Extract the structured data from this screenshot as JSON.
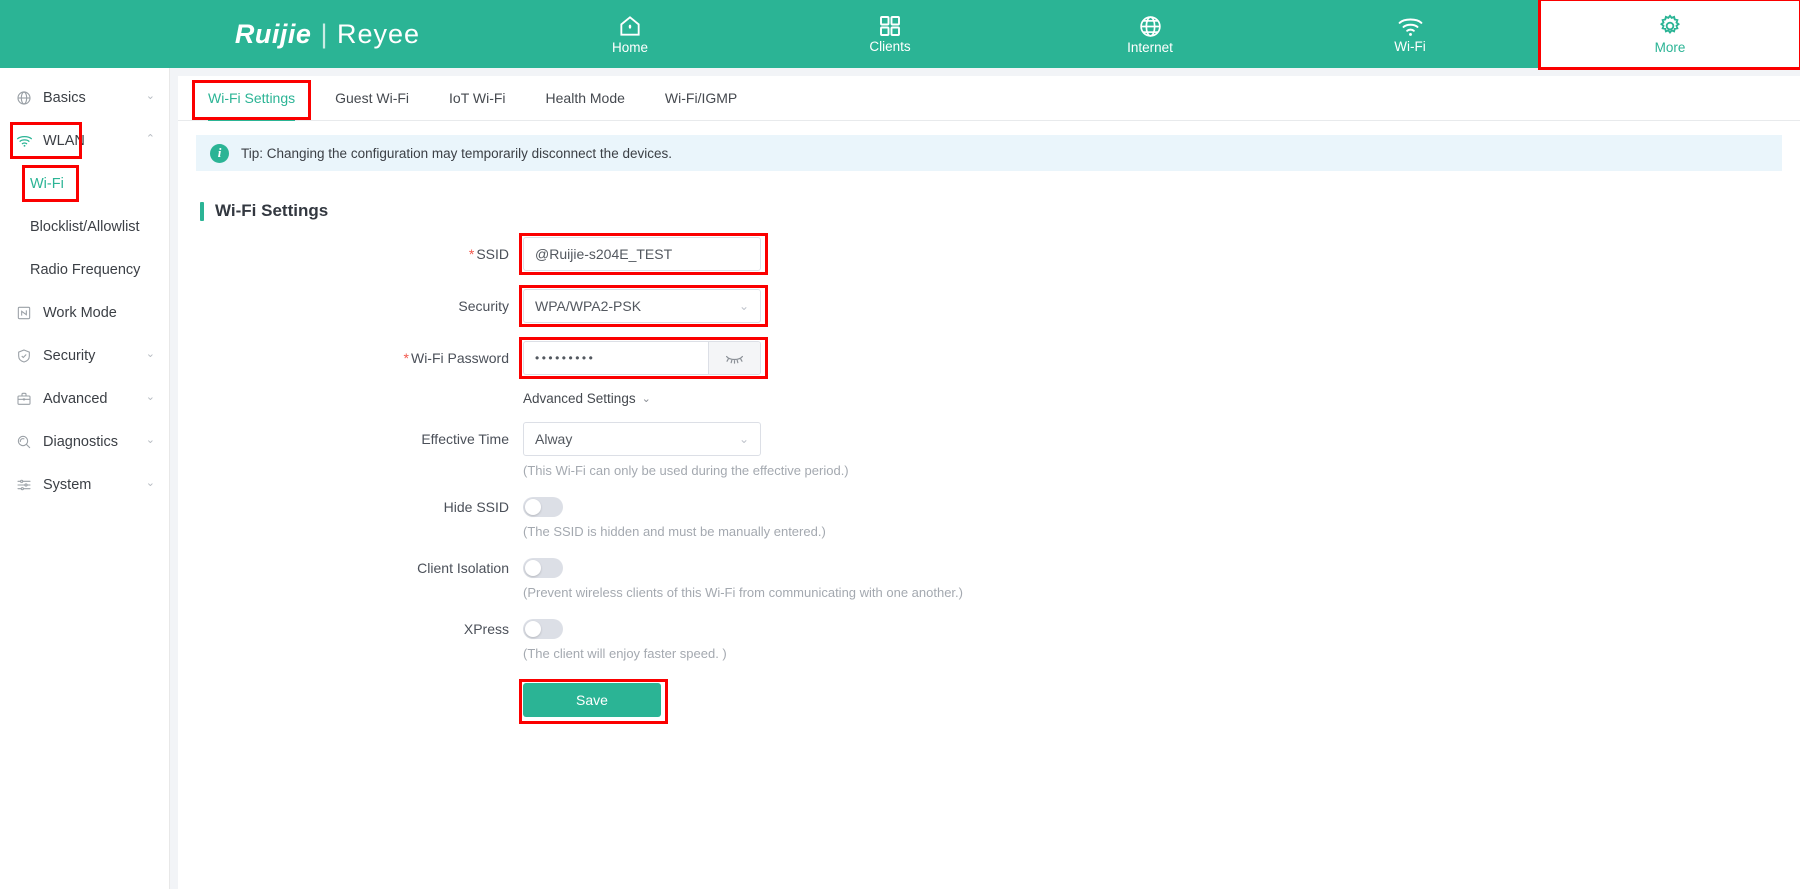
{
  "header": {
    "brand_primary": "Ruijie",
    "brand_separator": "|",
    "brand_secondary": "Reyee",
    "nav": [
      {
        "label": "Home",
        "icon": "home-icon",
        "active": false
      },
      {
        "label": "Clients",
        "icon": "grid-icon",
        "active": false
      },
      {
        "label": "Internet",
        "icon": "globe-icon",
        "active": false
      },
      {
        "label": "Wi-Fi",
        "icon": "wifi-icon",
        "active": false
      },
      {
        "label": "More",
        "icon": "gear-icon",
        "active": true
      }
    ]
  },
  "sidebar": {
    "items": [
      {
        "label": "Basics",
        "icon": "globe-icon",
        "caret": "⌄",
        "expanded": false
      },
      {
        "label": "WLAN",
        "icon": "wifi-icon",
        "caret": "⌃",
        "expanded": true
      },
      {
        "label": "Work Mode",
        "icon": "workmode-icon",
        "caret": "",
        "expanded": false
      },
      {
        "label": "Security",
        "icon": "shield-icon",
        "caret": "⌄",
        "expanded": false
      },
      {
        "label": "Advanced",
        "icon": "briefcase-icon",
        "caret": "⌄",
        "expanded": false
      },
      {
        "label": "Diagnostics",
        "icon": "diagnostics-icon",
        "caret": "⌄",
        "expanded": false
      },
      {
        "label": "System",
        "icon": "system-icon",
        "caret": "⌄",
        "expanded": false
      }
    ],
    "wlan_children": [
      {
        "label": "Wi-Fi",
        "selected": true
      },
      {
        "label": "Blocklist/Allowlist",
        "selected": false
      },
      {
        "label": "Radio Frequency",
        "selected": false
      }
    ]
  },
  "tabs": [
    {
      "label": "Wi-Fi Settings",
      "active": true
    },
    {
      "label": "Guest Wi-Fi",
      "active": false
    },
    {
      "label": "IoT Wi-Fi",
      "active": false
    },
    {
      "label": "Health Mode",
      "active": false
    },
    {
      "label": "Wi-Fi/IGMP",
      "active": false
    }
  ],
  "tip": {
    "icon": "info-icon",
    "text": "Tip: Changing the configuration may temporarily disconnect the devices."
  },
  "section": {
    "title": "Wi-Fi Settings"
  },
  "form": {
    "ssid": {
      "required_mark": "*",
      "label": "SSID",
      "value": "@Ruijie-s204E_TEST"
    },
    "security": {
      "label": "Security",
      "value": "WPA/WPA2-PSK",
      "chevron": "⌄"
    },
    "password": {
      "required_mark": "*",
      "label": "Wi-Fi Password",
      "value": "•••••••••",
      "eye_icon": "eye-closed-icon"
    },
    "advanced_settings": {
      "label": "Advanced Settings",
      "chevron": "⌄"
    },
    "effective_time": {
      "label": "Effective Time",
      "value": "Alway",
      "chevron": "⌄",
      "hint": "(This Wi-Fi can only be used during the effective period.)"
    },
    "hide_ssid": {
      "label": "Hide SSID",
      "on": false,
      "hint": "(The SSID is hidden and must be manually entered.)"
    },
    "client_isolation": {
      "label": "Client Isolation",
      "on": false,
      "hint": "(Prevent wireless clients of this Wi-Fi from communicating with one another.)"
    },
    "xpress": {
      "label": "XPress",
      "on": false,
      "hint": "(The client will enjoy faster speed. )"
    },
    "save_label": "Save"
  },
  "colors": {
    "brand_teal": "#2bb495",
    "highlight_red": "#fb0000",
    "tip_bg": "#eaf5fb"
  }
}
